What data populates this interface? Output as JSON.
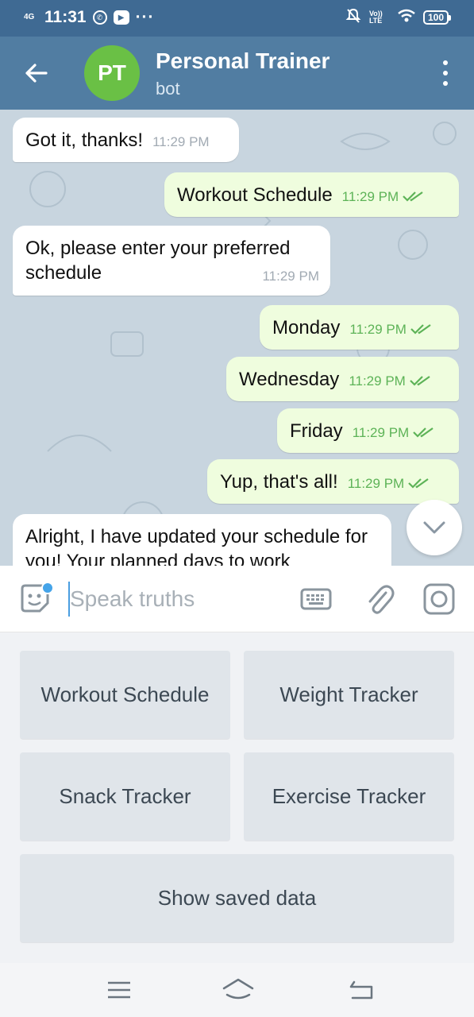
{
  "status_bar": {
    "network": "4G",
    "time": "11:31",
    "more": "···",
    "lte": "Vo)) LTE",
    "battery": "100"
  },
  "header": {
    "avatar_initials": "PT",
    "title": "Personal Trainer",
    "subtitle": "bot"
  },
  "messages": [
    {
      "dir": "in",
      "text": "Got it, thanks!",
      "time": "11:29 PM"
    },
    {
      "dir": "out",
      "text": "Workout Schedule",
      "time": "11:29 PM"
    },
    {
      "dir": "in",
      "text": "Ok, please enter your preferred schedule",
      "time": "11:29 PM"
    },
    {
      "dir": "out",
      "text": "Monday",
      "time": "11:29 PM"
    },
    {
      "dir": "out",
      "text": "Wednesday",
      "time": "11:29 PM"
    },
    {
      "dir": "out",
      "text": "Friday",
      "time": "11:29 PM"
    },
    {
      "dir": "out",
      "text": "Yup, that's all!",
      "time": "11:29 PM"
    },
    {
      "dir": "in",
      "text": "Alright, I have updated your schedule for you! Your planned days to work",
      "time": ""
    }
  ],
  "input": {
    "placeholder": "Speak truths",
    "value": ""
  },
  "keyboard_buttons": [
    {
      "label": "Workout Schedule"
    },
    {
      "label": "Weight Tracker"
    },
    {
      "label": "Snack Tracker"
    },
    {
      "label": "Exercise Tracker"
    },
    {
      "label": "Show saved data"
    }
  ],
  "colors": {
    "header": "#517da2",
    "status_bar": "#3f6a93",
    "avatar": "#6ac045",
    "outgoing_bubble": "#effdde",
    "incoming_bubble": "#ffffff",
    "chat_background": "#c8d5df",
    "accent": "#45a4e9"
  },
  "icons": [
    "back-arrow-icon",
    "more-vert-icon",
    "sticker-icon",
    "keyboard-icon",
    "attach-icon",
    "camera-icon",
    "chevron-down-icon",
    "double-check-icon",
    "nav-menu-icon",
    "nav-home-icon",
    "nav-back-icon"
  ]
}
